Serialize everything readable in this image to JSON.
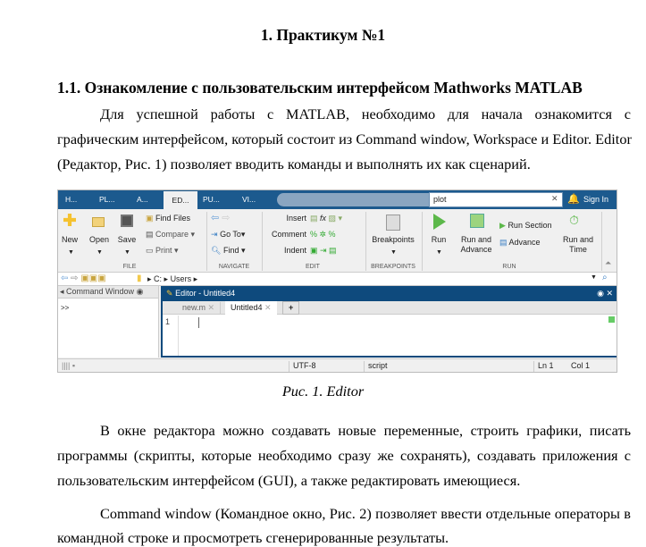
{
  "title": "1. Практикум №1",
  "section_heading": "1.1. Ознакомление с пользовательским интерфейсом Mathworks MATLAB",
  "para1": [
    "Для успешной работы с MATLAB, необходимо для начала ознакомится с",
    "графическим интерфейсом, который состоит из Command window, Workspace и Editor. Editor",
    "(Редактор, Рис. 1) позволяет вводить команды и выполнять их как сценарий."
  ],
  "caption": "Рис. 1. Editor",
  "para2": [
    "В окне редактора можно создавать новые переменные, строить графики, писать",
    "программы (скрипты, которые необходимо сразу же сохранять), создавать приложения с",
    "пользовательским интерфейсом (GUI), а также редактировать имеющиеся."
  ],
  "para3": [
    "Command window (Командное окно, Рис. 2) позволяет ввести отдельные операторы в",
    "командной строке и просмотреть сгенерированные результаты."
  ],
  "matlab": {
    "tabs": [
      "H...",
      "PL...",
      "A...",
      "ED...",
      "PU...",
      "VI..."
    ],
    "search_value": "plot",
    "sign_in": "Sign In",
    "file": {
      "new": "New",
      "open": "Open",
      "save": "Save",
      "find_files": "Find Files",
      "compare": "Compare",
      "print": "Print",
      "group": "FILE"
    },
    "navigate": {
      "goto": "Go To",
      "find": "Find",
      "group": "NAVIGATE"
    },
    "edit": {
      "insert": "Insert",
      "comment": "Comment",
      "indent": "Indent",
      "fx": "fx",
      "group": "EDIT"
    },
    "breakpoints": {
      "label": "Breakpoints",
      "group": "BREAKPOINTS"
    },
    "run": {
      "run": "Run",
      "run_advance": "Run and Advance",
      "run_section": "Run Section",
      "advance": "Advance",
      "run_time": "Run and Time",
      "group": "RUN"
    },
    "path": [
      "C:",
      "Users"
    ],
    "command_window": {
      "title": "Command Window",
      "prompt": ">>"
    },
    "editor": {
      "title": "Editor - Untitled4",
      "tabs": [
        "new.m",
        "Untitled4"
      ],
      "add": "+",
      "line_number": "1"
    },
    "status": {
      "encoding": "UTF-8",
      "type": "script",
      "ln": "Ln  1",
      "col": "Col  1"
    }
  }
}
